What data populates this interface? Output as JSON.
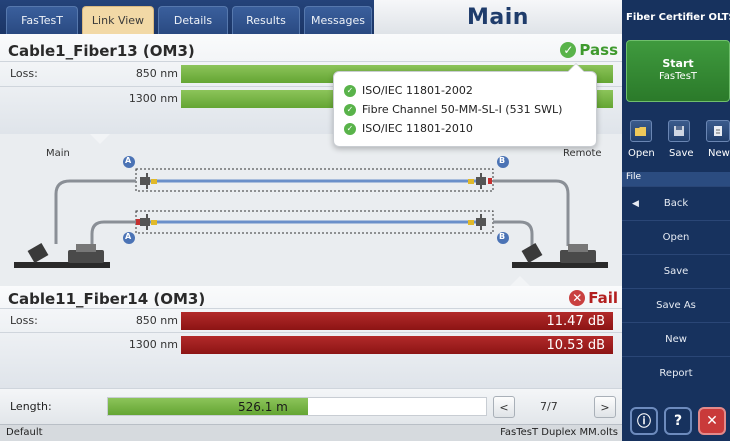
{
  "tabs": [
    {
      "label": "FasTesT"
    },
    {
      "label": "Link View",
      "active": true
    },
    {
      "label": "Details"
    },
    {
      "label": "Results"
    },
    {
      "label": "Messages"
    }
  ],
  "main_title": "Main",
  "cable1": {
    "name": "Cable1_Fiber13 (OM3)",
    "status": "Pass",
    "loss_label": "Loss:",
    "rows": [
      {
        "wavelength": "850 nm",
        "value": ""
      },
      {
        "wavelength": "1300 nm",
        "value": ""
      }
    ]
  },
  "tooltip": {
    "standards": [
      "ISO/IEC 11801-2002",
      "Fibre Channel 50-MM-SL-I (531 SWL)",
      "ISO/IEC 11801-2010"
    ]
  },
  "diagram": {
    "left_label": "Main",
    "right_label": "Remote",
    "port_a": "A",
    "port_b": "B"
  },
  "cable2": {
    "name": "Cable11_Fiber14 (OM3)",
    "status": "Fail",
    "loss_label": "Loss:",
    "rows": [
      {
        "wavelength": "850 nm",
        "value": "11.47 dB"
      },
      {
        "wavelength": "1300 nm",
        "value": "10.53 dB"
      }
    ]
  },
  "length": {
    "label": "Length:",
    "value": "526.1 m",
    "page": "7/7",
    "prev": "<",
    "next": ">"
  },
  "statusbar": {
    "left": "Default",
    "right": "FasTesT Duplex MM.olts"
  },
  "right_panel": {
    "title": "Fiber Certifier OLTS",
    "start_label": "Start",
    "start_sub": "FasTesT",
    "open_label": "Open",
    "save_label": "Save",
    "new_label": "New",
    "file_header": "File",
    "menu": [
      "Back",
      "Open",
      "Save",
      "Save As",
      "New",
      "Report"
    ]
  },
  "colors": {
    "pass_green": "#64a533",
    "fail_red": "#8c1414",
    "panel_blue": "#17325e",
    "tab_active": "#f2d9a6"
  }
}
